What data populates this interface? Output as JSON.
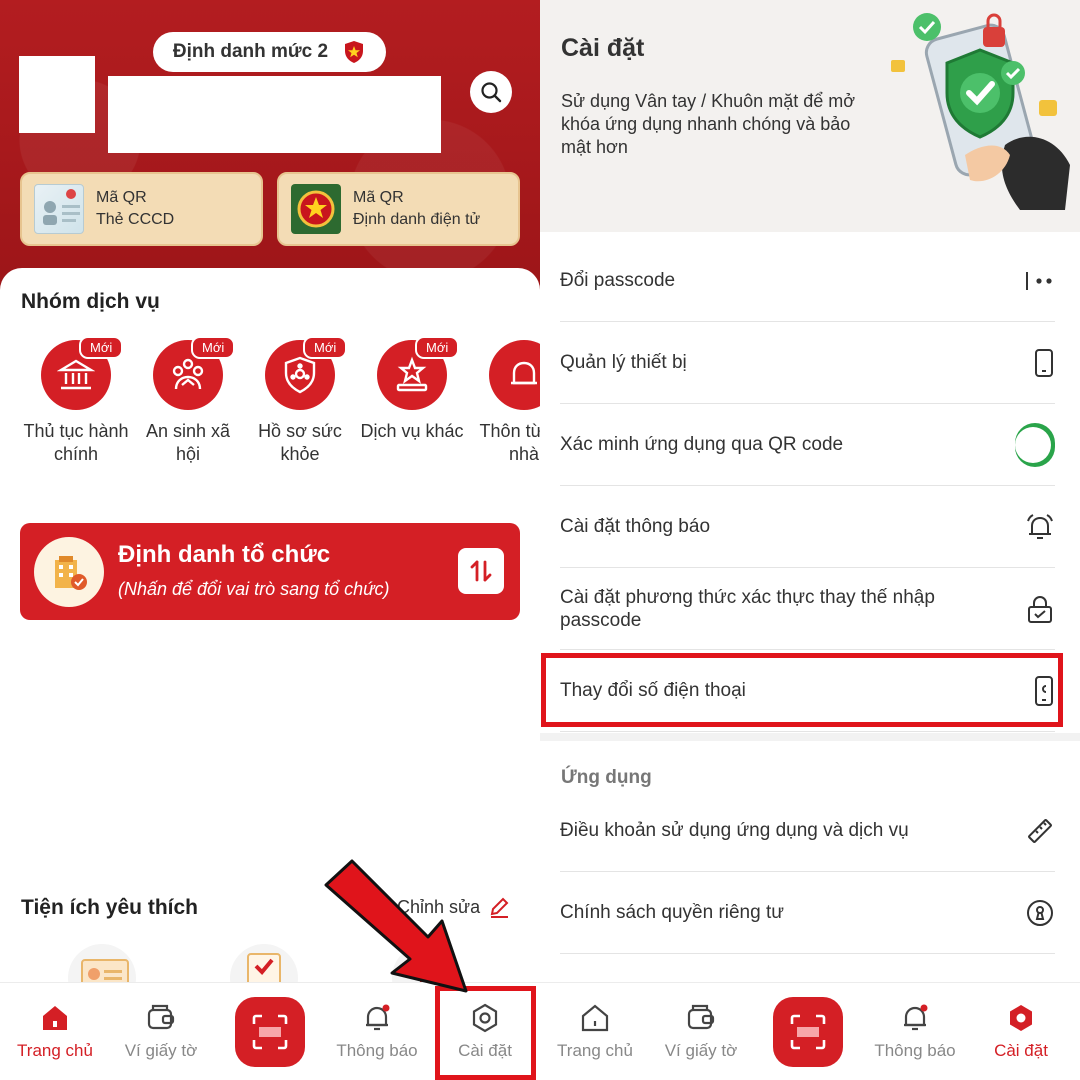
{
  "left": {
    "level_label": "Định danh mức 2",
    "qr_cards": [
      {
        "line1": "Mã QR",
        "line2": "Thẻ CCCD"
      },
      {
        "line1": "Mã QR",
        "line2": "Định danh điện tử"
      }
    ],
    "services_title": "Nhóm dịch vụ",
    "new_tag": "Mới",
    "services": [
      {
        "label": "Thủ tục hành chính",
        "icon": "bank-icon",
        "new": true
      },
      {
        "label": "An sinh xã hội",
        "icon": "family-icon",
        "new": true
      },
      {
        "label": "Hồ sơ sức khỏe",
        "icon": "health-shield-icon",
        "new": true
      },
      {
        "label": "Dịch vụ khác",
        "icon": "star-podium-icon",
        "new": true
      },
      {
        "label": "Thôn từ cơ nhà",
        "icon": "bell-icon",
        "new": false
      }
    ],
    "org_card": {
      "title": "Định danh tổ chức",
      "subtitle": "(Nhấn để đổi vai trò sang tổ chức)"
    },
    "favorites_title": "Tiện ích yêu thích",
    "favorites_edit": "Chỉnh sửa"
  },
  "right": {
    "title": "Cài đặt",
    "description": "Sử dụng Vân tay / Khuôn mặt để mở  khóa ứng dụng nhanh chóng và bảo mật hơn",
    "rows": [
      {
        "label": "Đổi passcode",
        "icon": "passcode-dots-icon"
      },
      {
        "label": "Quản lý thiết bị",
        "icon": "phone-icon"
      },
      {
        "label": "Xác minh ứng dụng qua QR code",
        "icon": "toggle-switch",
        "toggle_on": true
      },
      {
        "label": "Cài đặt thông báo",
        "icon": "alarm-bell-icon"
      },
      {
        "label": "Cài đặt phương thức xác thực thay thế nhập passcode",
        "icon": "lock-check-icon"
      },
      {
        "label": "Thay đổi số điện thoại",
        "icon": "phone-change-icon"
      }
    ],
    "section_app": "Ứng dụng",
    "app_rows": [
      {
        "label": "Điều khoản sử dụng ứng dụng và dịch vụ",
        "icon": "ruler-icon"
      },
      {
        "label": "Chính sách quyền riêng tư",
        "icon": "keyhole-icon"
      }
    ]
  },
  "nav": {
    "home": "Trang chủ",
    "wallet": "Ví giấy tờ",
    "notifications": "Thông báo",
    "settings": "Cài đặt"
  },
  "colors": {
    "brand_red": "#d41f25",
    "header_red": "#a8181c",
    "toggle_green": "#2aa44a",
    "annotation_red": "#e0141b"
  }
}
